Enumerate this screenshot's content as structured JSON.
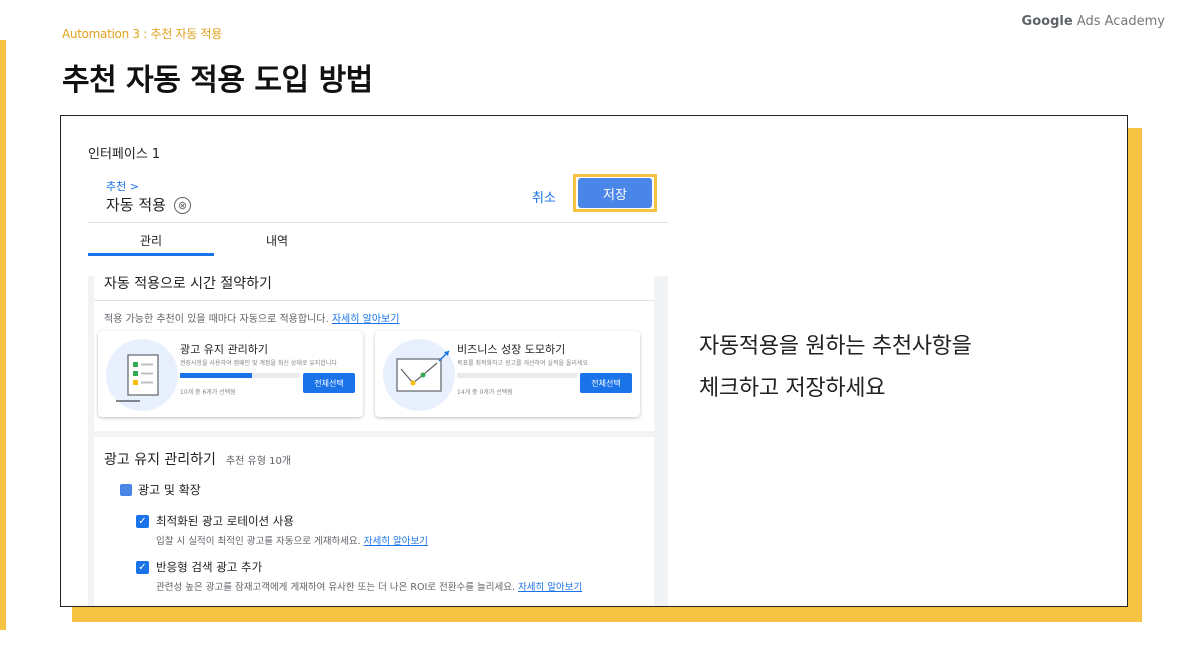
{
  "slide": {
    "kicker": "Automation 3 : 추천 자동 적용",
    "brand_bold": "Google",
    "brand_rest": " Ads Academy",
    "title": "추천 자동 적용 도입 방법",
    "interface_label": "인터페이스 1",
    "callout_line1": "자동적용을 원하는 추천사항을",
    "callout_line2": "체크하고 저장하세요",
    "accent_color": "#f5c242"
  },
  "panel": {
    "breadcrumb": "추천 >",
    "title": "자동 적용",
    "close_icon": "⊗",
    "cancel_label": "취소",
    "save_label": "저장",
    "tabs": [
      {
        "label": "관리",
        "active": true
      },
      {
        "label": "내역",
        "active": false
      }
    ],
    "section1": {
      "title": "자동 적용으로 시간 절약하기",
      "description": "적용 가능한 추천이 있을 때마다 자동으로 적용합니다.",
      "learn_more": "자세히 알아보기",
      "cards": [
        {
          "title": "광고 유지 관리하기",
          "subtitle": "권장사항을 사용하여 캠페인 및 계정을 최신 상태로 유지합니다",
          "count": "10개 중 6개가 선택됨",
          "progress": 0.6,
          "button": "전체선택"
        },
        {
          "title": "비즈니스 성장 도모하기",
          "subtitle": "목표를 최적화하고 광고를 개선하여 실적을 올리세요",
          "count": "14개 중 0개가 선택됨",
          "progress": 0,
          "button": "전체선택"
        }
      ]
    },
    "section2": {
      "title": "광고 유지 관리하기",
      "meta": "추천 유형 10개",
      "category": "광고 및 확장",
      "items": [
        {
          "title": "최적화된 광고 로테이션 사용",
          "description": "입찰 시 실적이 최적인 광고를 자동으로 게재하세요.",
          "learn_more": "자세히 알아보기",
          "checked": true
        },
        {
          "title": "반응형 검색 광고 추가",
          "description": "관련성 높은 광고를 잠재고객에게 게재하여 유사한 또는 더 나은 ROI로 전환수를 늘리세요.",
          "learn_more": "자세히 알아보기",
          "checked": true
        }
      ]
    }
  }
}
